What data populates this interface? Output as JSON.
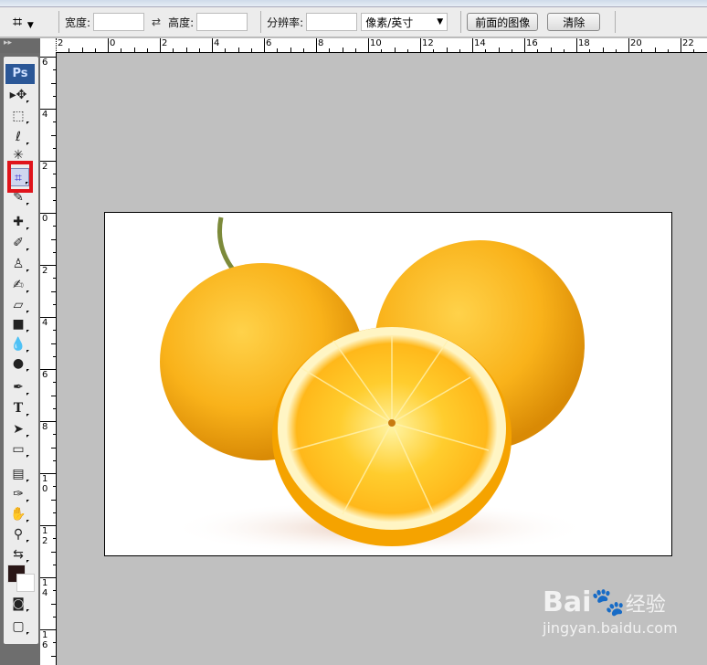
{
  "options_bar": {
    "width_label": "宽度:",
    "width_value": "",
    "height_label": "高度:",
    "height_value": "",
    "resolution_label": "分辨率:",
    "resolution_value": "",
    "unit_select": "像素/英寸",
    "front_image_button": "前面的图像",
    "clear_button": "清除"
  },
  "rulers": {
    "horizontal": [
      "2",
      "0",
      "2",
      "4",
      "6",
      "8",
      "10",
      "12",
      "14",
      "16",
      "18",
      "20",
      "22"
    ],
    "vertical": [
      "6",
      "4",
      "2",
      "0",
      "2",
      "4",
      "6",
      "8",
      "10",
      "12",
      "14",
      "16"
    ]
  },
  "tools": {
    "logo": "Ps",
    "text_tool": "T"
  },
  "colors": {
    "foreground": "#2a1717",
    "background": "#ffffff",
    "highlight": "#e0141b"
  },
  "watermark": {
    "brand": "Bai",
    "brand2": "经验",
    "url": "jingyan.baidu.com"
  }
}
